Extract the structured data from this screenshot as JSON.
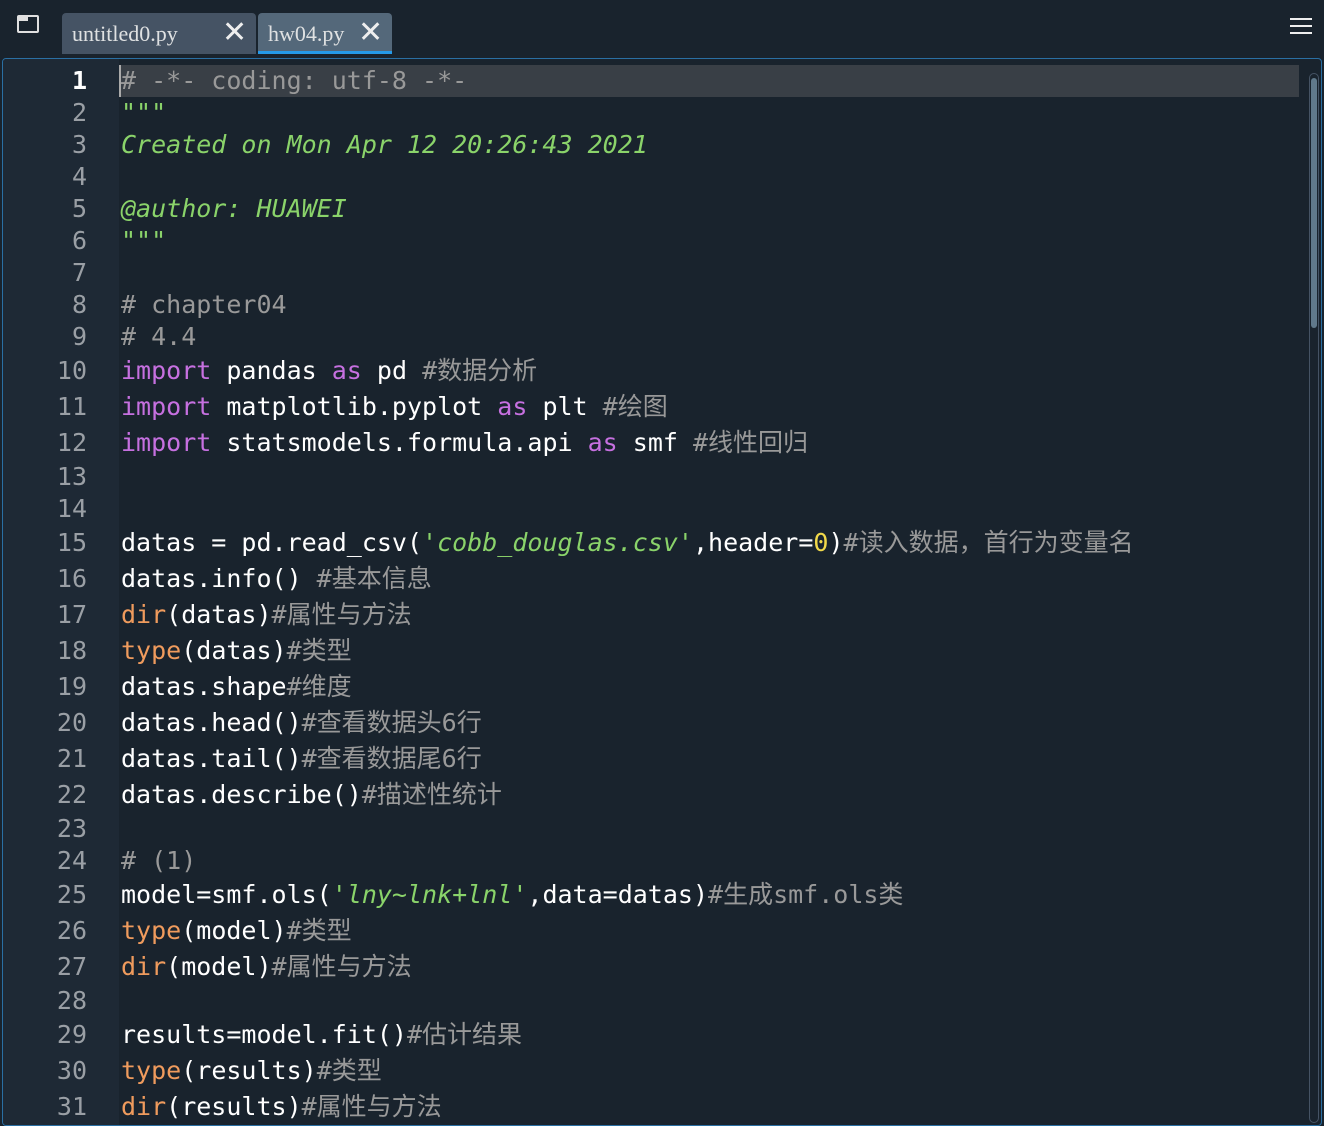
{
  "tabs": [
    {
      "label": "untitled0.py",
      "active": false
    },
    {
      "label": "hw04.py",
      "active": true
    }
  ],
  "close_glyph": "✕",
  "current_line": 1,
  "lines": [
    [
      [
        "cm",
        "# -*- coding: utf-8 -*-"
      ]
    ],
    [
      [
        "str",
        "\"\"\""
      ]
    ],
    [
      [
        "str",
        "Created on Mon Apr 12 20:26:43 2021"
      ]
    ],
    [],
    [
      [
        "str",
        "@author: HUAWEI"
      ]
    ],
    [
      [
        "str",
        "\"\"\""
      ]
    ],
    [],
    [
      [
        "cm",
        "# chapter04"
      ]
    ],
    [
      [
        "cm",
        "# 4.4"
      ]
    ],
    [
      [
        "kw",
        "import"
      ],
      [
        "pl",
        " pandas "
      ],
      [
        "kw",
        "as"
      ],
      [
        "pl",
        " pd "
      ],
      [
        "cm",
        "#数据分析"
      ]
    ],
    [
      [
        "kw",
        "import"
      ],
      [
        "pl",
        " matplotlib.pyplot "
      ],
      [
        "kw",
        "as"
      ],
      [
        "pl",
        " plt "
      ],
      [
        "cm",
        "#绘图"
      ]
    ],
    [
      [
        "kw",
        "import"
      ],
      [
        "pl",
        " statsmodels.formula.api "
      ],
      [
        "kw",
        "as"
      ],
      [
        "pl",
        " smf "
      ],
      [
        "cm",
        "#线性回归"
      ]
    ],
    [],
    [],
    [
      [
        "pl",
        "datas = pd.read_csv("
      ],
      [
        "str",
        "'cobb_douglas.csv'"
      ],
      [
        "pl",
        ",header="
      ],
      [
        "num0",
        "0"
      ],
      [
        "pl",
        ")"
      ],
      [
        "cm",
        "#读入数据，首行为变量名"
      ]
    ],
    [
      [
        "pl",
        "datas.info() "
      ],
      [
        "cm",
        "#基本信息"
      ]
    ],
    [
      [
        "bi",
        "dir"
      ],
      [
        "pl",
        "(datas)"
      ],
      [
        "cm",
        "#属性与方法"
      ]
    ],
    [
      [
        "bi",
        "type"
      ],
      [
        "pl",
        "(datas)"
      ],
      [
        "cm",
        "#类型"
      ]
    ],
    [
      [
        "pl",
        "datas.shape"
      ],
      [
        "cm",
        "#维度"
      ]
    ],
    [
      [
        "pl",
        "datas.head()"
      ],
      [
        "cm",
        "#查看数据头6行"
      ]
    ],
    [
      [
        "pl",
        "datas.tail()"
      ],
      [
        "cm",
        "#查看数据尾6行"
      ]
    ],
    [
      [
        "pl",
        "datas.describe()"
      ],
      [
        "cm",
        "#描述性统计"
      ]
    ],
    [],
    [
      [
        "cm",
        "# (1)"
      ]
    ],
    [
      [
        "pl",
        "model=smf.ols("
      ],
      [
        "str",
        "'lny~lnk+lnl'"
      ],
      [
        "pl",
        ",data=datas)"
      ],
      [
        "cm",
        "#生成smf.ols类"
      ]
    ],
    [
      [
        "bi",
        "type"
      ],
      [
        "pl",
        "(model)"
      ],
      [
        "cm",
        "#类型"
      ]
    ],
    [
      [
        "bi",
        "dir"
      ],
      [
        "pl",
        "(model)"
      ],
      [
        "cm",
        "#属性与方法"
      ]
    ],
    [],
    [
      [
        "pl",
        "results=model.fit()"
      ],
      [
        "cm",
        "#估计结果"
      ]
    ],
    [
      [
        "bi",
        "type"
      ],
      [
        "pl",
        "(results)"
      ],
      [
        "cm",
        "#类型"
      ]
    ],
    [
      [
        "bi",
        "dir"
      ],
      [
        "pl",
        "(results)"
      ],
      [
        "cm",
        "#属性与方法"
      ]
    ]
  ]
}
